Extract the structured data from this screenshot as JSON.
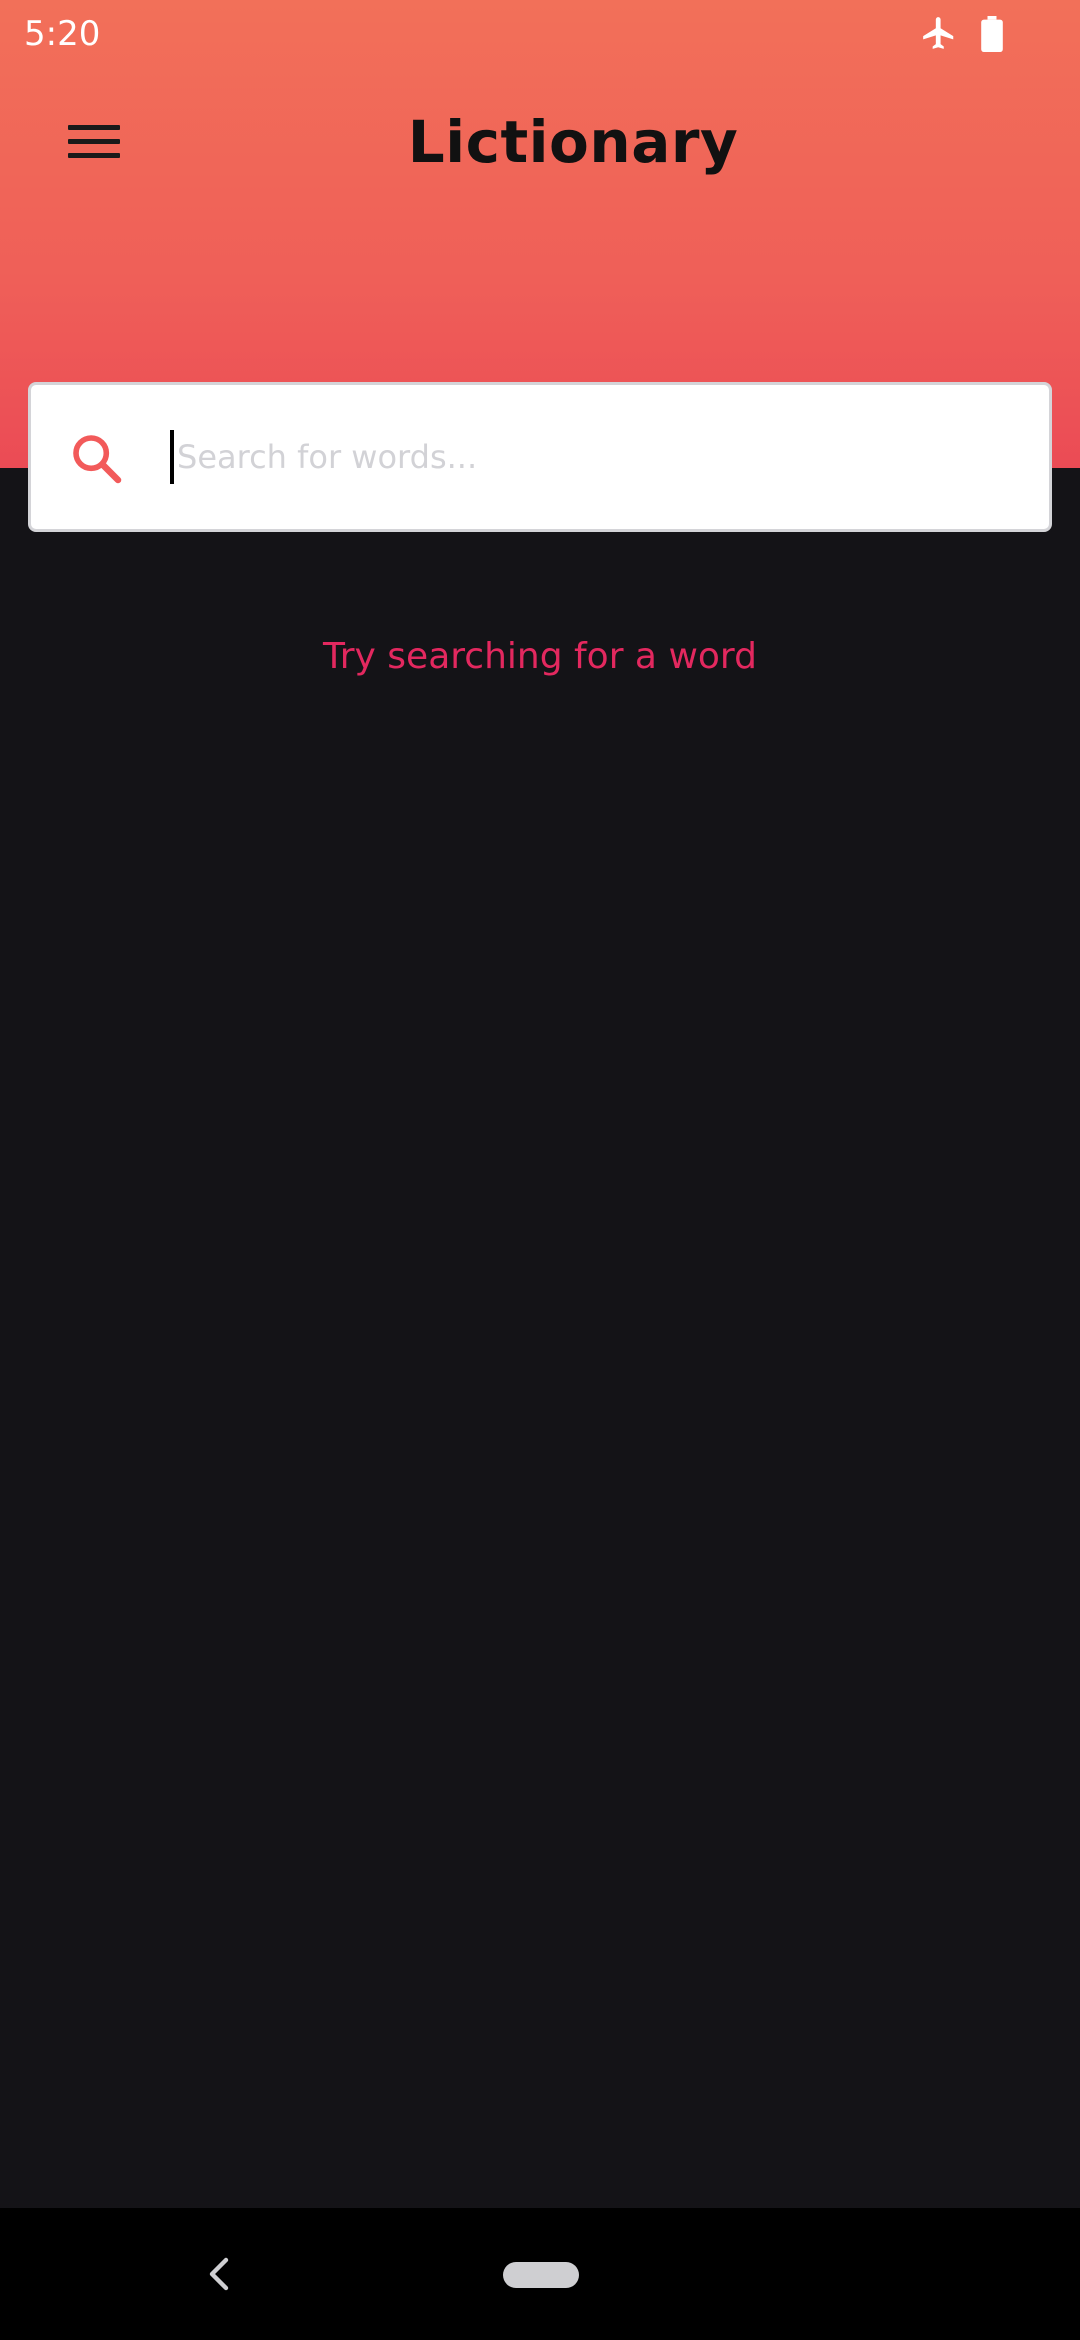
{
  "status_bar": {
    "time": "5:20",
    "icons": [
      "airplane-icon",
      "battery-icon"
    ]
  },
  "header": {
    "title": "Lictionary",
    "menu_icon": "menu-icon"
  },
  "search": {
    "placeholder": "Search for words...",
    "value": "",
    "icon": "search-icon"
  },
  "empty_state": {
    "text": "Try searching for a word"
  },
  "nav_bar": {
    "buttons": [
      "back-icon",
      "home-pill"
    ]
  },
  "colors": {
    "header_top": "#f27059",
    "header_bottom": "#eb4b55",
    "background": "#141317",
    "accent": "#e3285f",
    "search_icon": "#f25a5a"
  }
}
